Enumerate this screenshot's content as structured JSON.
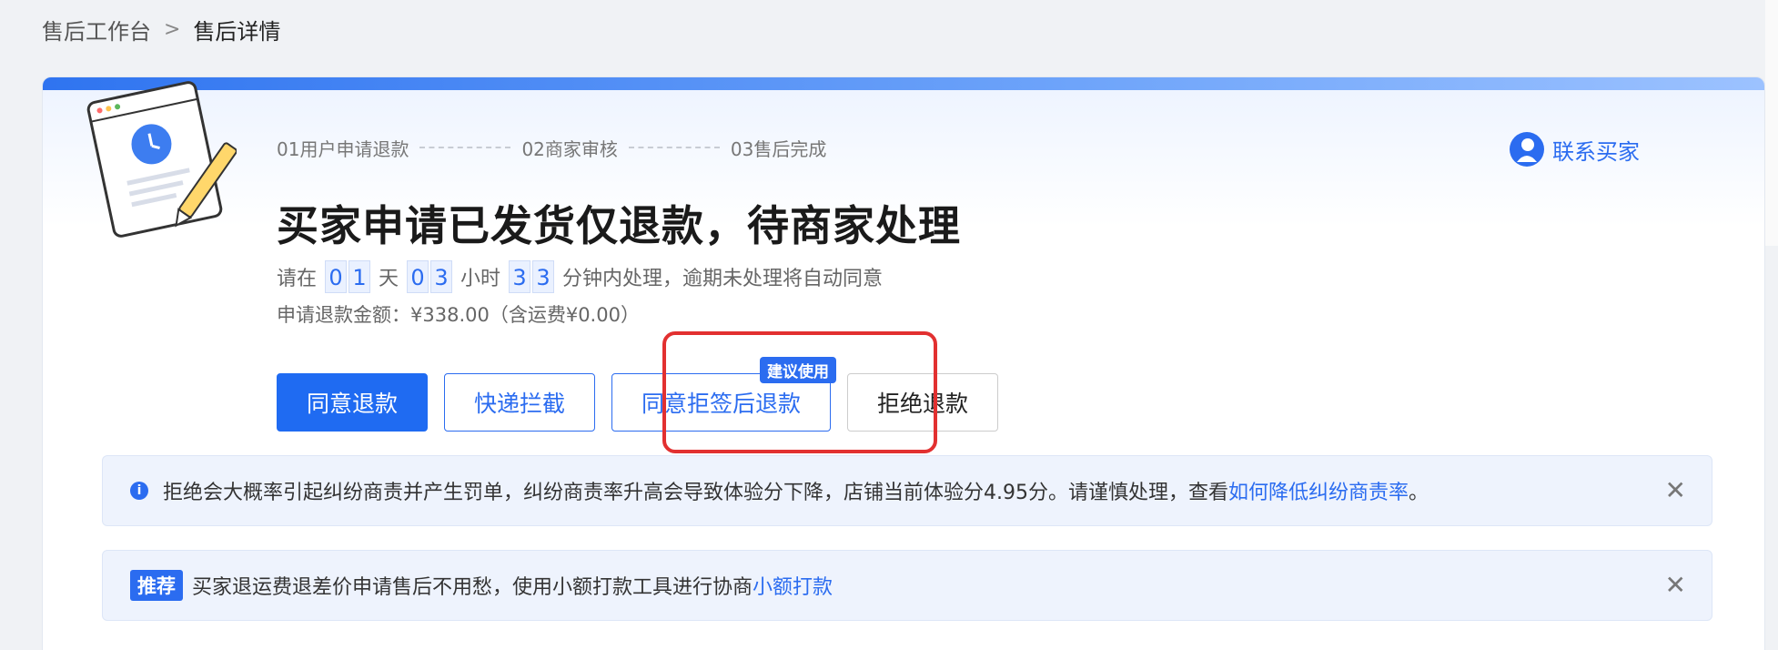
{
  "breadcrumb": {
    "parent": "售后工作台",
    "separator": ">",
    "current": "售后详情"
  },
  "steps": [
    {
      "label": "01用户申请退款"
    },
    {
      "label": "02商家审核"
    },
    {
      "label": "03售后完成"
    }
  ],
  "contact": {
    "label": "联系买家"
  },
  "title": "买家申请已发货仅退款，待商家处理",
  "countdown": {
    "prefix": "请在",
    "days": [
      "0",
      "1"
    ],
    "days_unit": "天",
    "hours": [
      "0",
      "3"
    ],
    "hours_unit": "小时",
    "minutes": [
      "3",
      "3"
    ],
    "suffix": "分钟内处理，逾期未处理将自动同意"
  },
  "amount": "申请退款金额：¥338.00（含运费¥0.00）",
  "actions": {
    "agree": "同意退款",
    "intercept": "快递拦截",
    "agree_after_reject": "同意拒签后退款",
    "recommend_badge": "建议使用",
    "reject": "拒绝退款"
  },
  "notices": {
    "warning_text": "拒绝会大概率引起纠纷商责并产生罚单，纠纷商责率升高会导致体验分下降，店铺当前体验分4.95分。请谨慎处理，查看",
    "warning_link": "如何降低纠纷商责率",
    "warning_end": "。",
    "recommend_tag": "推荐",
    "recommend_text": "买家退运费退差价申请售后不用愁，使用小额打款工具进行协商",
    "recommend_link": "小额打款",
    "close_glyph": "✕"
  },
  "colors": {
    "accent": "#2b6cf0",
    "highlight": "#e23030"
  }
}
